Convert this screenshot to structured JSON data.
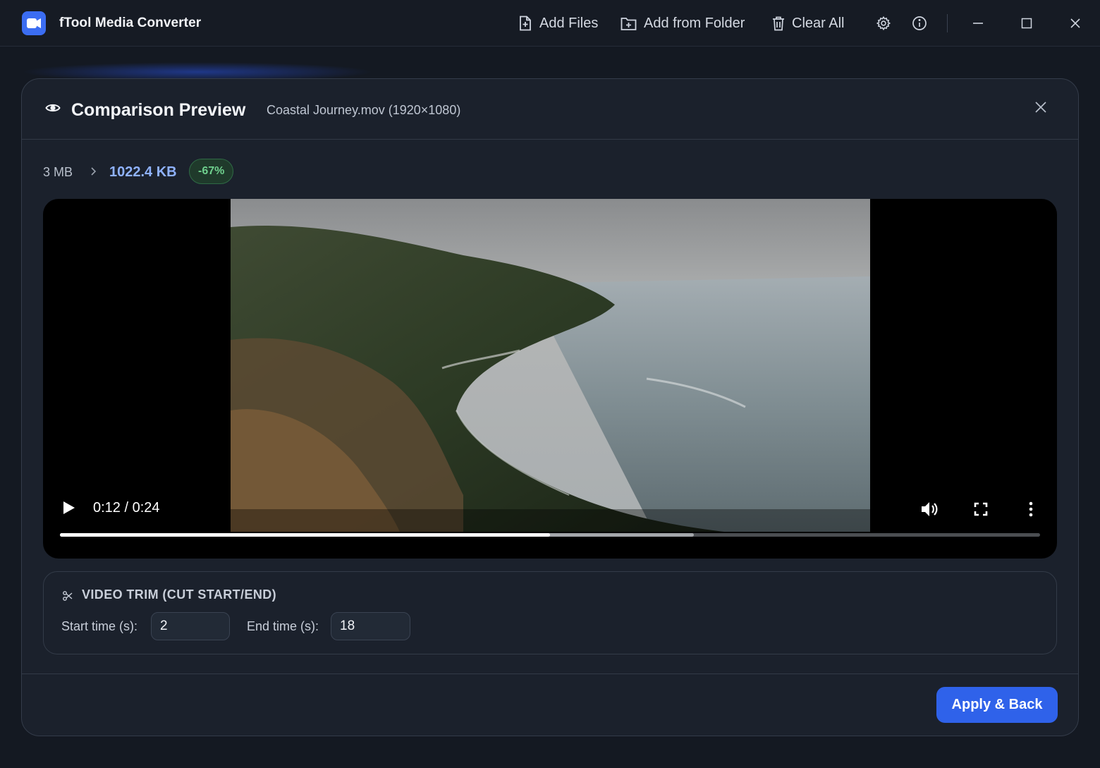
{
  "app": {
    "title": "fTool Media Converter",
    "accent": "#3b6df2"
  },
  "toolbar": {
    "add_files": "Add Files",
    "add_folder": "Add from Folder",
    "clear_all": "Clear All",
    "icons": [
      "settings-icon",
      "info-icon",
      "minimize-icon",
      "maximize-icon",
      "close-icon"
    ]
  },
  "modal": {
    "title": "Comparison Preview",
    "file_info": "Coastal Journey.mov (1920×1080)",
    "size": {
      "original": "3 MB",
      "new": "1022.4 KB",
      "reduction": "-67%",
      "reduction_color": "#6fd08e"
    },
    "player": {
      "time": "0:12 / 0:24",
      "played_fraction": 0.5,
      "buffered_fraction": 0.647
    },
    "trim": {
      "title": "VIDEO TRIM (CUT START/END)",
      "start_label": "Start time (s):",
      "start_value": "2",
      "end_label": "End time (s):",
      "end_value": "18"
    },
    "apply_label": "Apply & Back"
  }
}
